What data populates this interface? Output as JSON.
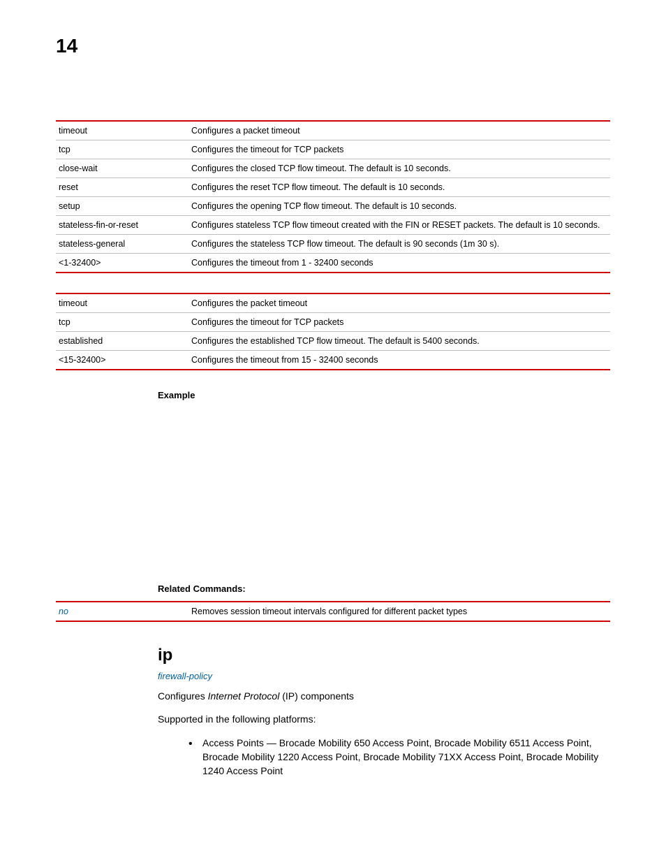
{
  "page_number": "14",
  "table1": {
    "rows": [
      {
        "param": "timeout",
        "desc": "Configures a packet timeout"
      },
      {
        "param": "tcp",
        "desc": "Configures the timeout for TCP packets"
      },
      {
        "param": "close-wait",
        "desc": "Configures the closed TCP flow timeout. The default is 10 seconds."
      },
      {
        "param": "reset",
        "desc": "Configures the reset TCP flow timeout. The default is 10 seconds."
      },
      {
        "param": "setup",
        "desc": "Configures the opening TCP flow timeout. The default is 10 seconds."
      },
      {
        "param": "stateless-fin-or-reset",
        "desc": "Configures stateless TCP flow timeout created with the FIN or RESET packets. The default is 10 seconds."
      },
      {
        "param": "stateless-general",
        "desc": "Configures the stateless TCP flow timeout. The default is 90 seconds (1m 30 s)."
      },
      {
        "param": "<1-32400>",
        "desc": "Configures the timeout from 1 - 32400 seconds"
      }
    ]
  },
  "table2": {
    "rows": [
      {
        "param": "timeout",
        "desc": "Configures the packet timeout"
      },
      {
        "param": "tcp",
        "desc": "Configures the timeout for TCP packets"
      },
      {
        "param": "established",
        "desc": "Configures the established TCP flow timeout. The default is 5400 seconds."
      },
      {
        "param": "<15-32400>",
        "desc": "Configures the timeout from 15 - 32400 seconds"
      }
    ]
  },
  "labels": {
    "example": "Example",
    "related": "Related Commands:"
  },
  "related_table": {
    "rows": [
      {
        "link": "no",
        "desc": "Removes session timeout intervals configured for different packet types"
      }
    ]
  },
  "ip_section": {
    "heading": "ip",
    "link": "firewall-policy",
    "desc_prefix": "Configures ",
    "desc_italic": "Internet Protocol",
    "desc_suffix": " (IP) components",
    "supported": "Supported in the following platforms:",
    "platforms": [
      "Access Points — Brocade Mobility 650 Access Point, Brocade Mobility 6511 Access Point, Brocade Mobility 1220 Access Point, Brocade Mobility 71XX Access Point, Brocade Mobility 1240 Access Point"
    ]
  }
}
